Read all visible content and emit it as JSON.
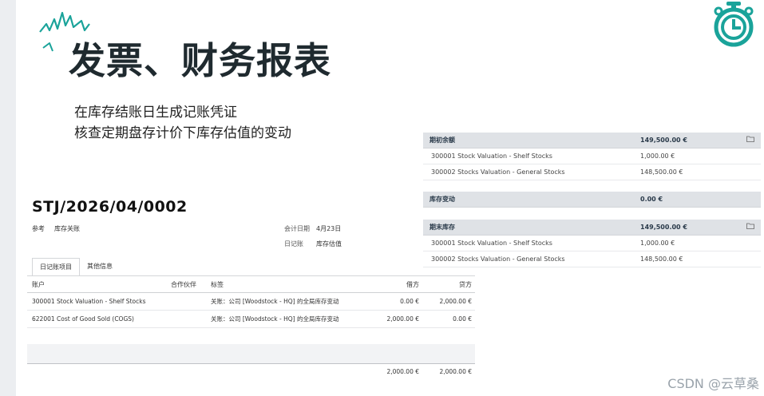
{
  "slide": {
    "title": "发票、财务报表",
    "bullets": [
      "在库存结账日生成记账凭证",
      "核查定期盘存计价下库存估值的变动"
    ],
    "accent_color": "#1aa39a",
    "icon": "stopwatch-icon"
  },
  "journal": {
    "reference": "STJ/2026/04/0002",
    "ref_label": "参考",
    "ref_value": "库存关账",
    "date_label": "会计日期",
    "date_value": "4月23日",
    "journal_label": "日记账",
    "journal_value": "库存估值",
    "tabs": [
      {
        "label": "日记账项目",
        "active": true
      },
      {
        "label": "其他信息",
        "active": false
      }
    ],
    "columns": {
      "account": "账户",
      "partner": "合作伙伴",
      "label": "标签",
      "debit": "借方",
      "credit": "贷方"
    },
    "lines": [
      {
        "account": "300001 Stock Valuation - Shelf Stocks",
        "partner": "",
        "label": "关账：公司 [Woodstock - HQ] 的全局库存变动",
        "debit": "0.00 €",
        "credit": "2,000.00 €"
      },
      {
        "account": "622001 Cost of Good Sold (COGS)",
        "partner": "",
        "label": "关账：公司 [Woodstock - HQ] 的全局库存变动",
        "debit": "2,000.00 €",
        "credit": "0.00 €"
      }
    ],
    "total_debit": "2,000.00 €",
    "total_credit": "2,000.00 €"
  },
  "report": {
    "opening": {
      "title": "期初余额",
      "amount": "149,500.00 €",
      "rows": [
        {
          "name": "300001 Stock Valuation - Shelf Stocks",
          "amount": "1,000.00 €"
        },
        {
          "name": "300002 Stocks Valuation - General Stocks",
          "amount": "148,500.00 €"
        }
      ]
    },
    "change": {
      "title": "库存变动",
      "amount": "0.00 €"
    },
    "closing": {
      "title": "期末库存",
      "amount": "149,500.00 €",
      "rows": [
        {
          "name": "300001 Stock Valuation - Shelf Stocks",
          "amount": "1,000.00 €"
        },
        {
          "name": "300002 Stocks Valuation - General Stocks",
          "amount": "148,500.00 €"
        }
      ]
    }
  },
  "watermark": "CSDN @云草桑"
}
